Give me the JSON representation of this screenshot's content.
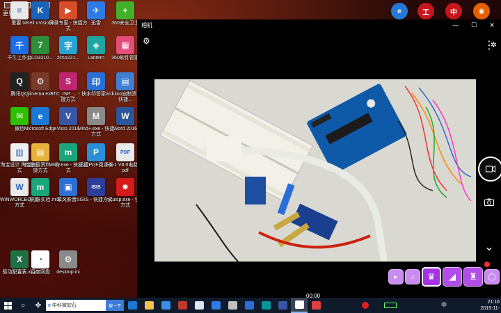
{
  "desktop": {
    "top_label": "更到看看",
    "icons": [
      {
        "label": "重要.txt",
        "icon": "text-file-icon",
        "glyph": "≡",
        "color": "#e9e9e9"
      },
      {
        "label": "Keil uVision4",
        "icon": "keil-icon",
        "glyph": "K",
        "color": "#1a63b8"
      },
      {
        "label": "屏录专家 - 快捷方式",
        "icon": "screen-recorder-icon",
        "glyph": "▶",
        "color": "#d84e2b"
      },
      {
        "label": "迅雷",
        "icon": "xunlei-icon",
        "glyph": "✈",
        "color": "#2f7be6"
      },
      {
        "label": "360安全卫士",
        "icon": "shield-plus-icon",
        "glyph": "+",
        "color": "#43b02a"
      },
      {
        "label": "千牛工作台",
        "icon": "qianniu-icon",
        "glyph": "千",
        "color": "#1e6de2"
      },
      {
        "label": "LCD3310...",
        "icon": "lcd-tool-icon",
        "glyph": "7",
        "color": "#2e8f3a"
      },
      {
        "label": "zimo221...",
        "icon": "zimo-icon",
        "glyph": "字",
        "color": "#27a3d4"
      },
      {
        "label": "Lantern",
        "icon": "lantern-icon",
        "glyph": "◈",
        "color": "#1fa4a4"
      },
      {
        "label": "360软件管家",
        "icon": "software-manager-icon",
        "glyph": "▦",
        "color": "#e44d7a"
      },
      {
        "label": "腾讯QQ",
        "icon": "qq-icon",
        "glyph": "Q",
        "color": "#222222"
      },
      {
        "label": "jiiniema.exe",
        "icon": "gear-exe-icon",
        "glyph": "⚙",
        "color": "#7a3b2b"
      },
      {
        "label": "STC_ISP_... - 快捷方式",
        "icon": "stc-isp-icon",
        "glyph": "S",
        "color": "#c0266f"
      },
      {
        "label": "水印管家",
        "icon": "watermark-icon",
        "glyph": "印",
        "color": "#2a6fd8"
      },
      {
        "label": "arduino自制资料 - 快捷...",
        "icon": "folder-icon",
        "glyph": "▤",
        "color": "#3c7fd4"
      },
      {
        "label": "微信",
        "icon": "wechat-icon",
        "glyph": "✉",
        "color": "#2dc100"
      },
      {
        "label": "Microsoft Edge",
        "icon": "edge-icon",
        "glyph": "e",
        "color": "#1b78d4"
      },
      {
        "label": "Visio 2016",
        "icon": "visio-icon",
        "glyph": "V",
        "color": "#3955a3"
      },
      {
        "label": "Mind+.exe - 快捷方式",
        "icon": "mindplus-icon",
        "glyph": "M",
        "color": "#8a8a8a"
      },
      {
        "label": "Word 2016",
        "icon": "word-icon",
        "glyph": "W",
        "color": "#2b579a"
      },
      {
        "label": "淘宝设计 - 快捷方式",
        "icon": "taobao-doc-icon",
        "glyph": "▥",
        "color": "#f0f0f0"
      },
      {
        "label": "淘宝底层资料 - 快捷方式",
        "icon": "folder-icon",
        "glyph": "▤",
        "color": "#e8b23a"
      },
      {
        "label": "Mixly.exe - 快捷方式",
        "icon": "mixly-icon",
        "glyph": "m",
        "color": "#19a67c"
      },
      {
        "label": "迅捷PDF阅读器",
        "icon": "pdf-reader-icon",
        "glyph": "P",
        "color": "#2a8fd8"
      },
      {
        "label": "HL-1 V8.0电路图.pdf",
        "icon": "pdf-file-icon",
        "glyph": "PDF",
        "color": "#e9e9e9"
      },
      {
        "label": "WINWORD - 快捷方式",
        "icon": "word-file-icon",
        "glyph": "W",
        "color": "#e9e9e9"
      },
      {
        "label": "LED闪烁实验.mix",
        "icon": "mixly-file-icon",
        "glyph": "m",
        "color": "#19a67c"
      },
      {
        "label": "幕风影音5",
        "icon": "video-player-icon",
        "glyph": "▣",
        "color": "#2d6fd3"
      },
      {
        "label": "ISIS - 快捷方式",
        "icon": "isis-icon",
        "glyph": "ISIS",
        "color": "#2c3e9a"
      },
      {
        "label": "mcuisp.exe - 快捷方式",
        "icon": "mcuisp-icon",
        "glyph": "✸",
        "color": "#d41a1a"
      },
      {
        "label": "驱动配置表.xlsx",
        "icon": "excel-file-icon",
        "glyph": "X",
        "color": "#1e7145"
      },
      {
        "label": "百度网盘",
        "icon": "baidu-netdisk-icon",
        "glyph": "◔",
        "color": "#ffffff"
      },
      {
        "label": "desktop.ini",
        "icon": "ini-file-icon",
        "glyph": "⚙",
        "color": "#8a8a8a"
      }
    ],
    "tray_icons": [
      {
        "icon": "ie-icon",
        "glyph": "e",
        "color": "#2479d4"
      },
      {
        "icon": "bank-icon",
        "glyph": "工",
        "color": "#c4161c"
      },
      {
        "icon": "bank-icon-2",
        "glyph": "中",
        "color": "#c4161c"
      },
      {
        "icon": "firefox-icon",
        "glyph": "◉",
        "color": "#e66000"
      }
    ]
  },
  "camera": {
    "title": "相机",
    "window_controls": [
      "—",
      "☐",
      "✕"
    ],
    "timer": "00:00",
    "stickers": [
      "▸",
      "♪",
      "♛",
      "◢",
      "♜",
      "◯"
    ]
  },
  "taskbar": {
    "search_text": "中科微软石",
    "search_button": "搜一下",
    "ime": "中",
    "clock_time": "21:16",
    "clock_date": "2019-11-"
  }
}
